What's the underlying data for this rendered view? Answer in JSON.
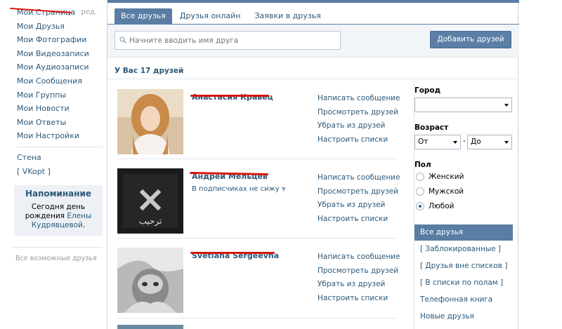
{
  "left_menu": {
    "items": [
      {
        "label": "Мои Страница"
      },
      {
        "label": "Мои Друзья"
      },
      {
        "label": "Мои Фотографии"
      },
      {
        "label": "Мои Видеозаписи"
      },
      {
        "label": "Мои Аудиозаписи"
      },
      {
        "label": "Мои Сообщения"
      },
      {
        "label": "Мои Группы"
      },
      {
        "label": "Мои Новости"
      },
      {
        "label": "Мои Ответы"
      },
      {
        "label": "Мои Настройки"
      }
    ],
    "edit_label": "ред.",
    "extra_items": [
      {
        "label": "Стена"
      },
      {
        "label": "[ VKopt ]"
      }
    ],
    "reminder": {
      "title": "Напоминание",
      "text_before": "Сегодня ",
      "link_day": "день рождения",
      "name": "Елены Кудрявцевой",
      "text_after": "."
    },
    "bottom_link": "Все возможные друзья"
  },
  "tabs": [
    {
      "label": "Все друзья",
      "active": true
    },
    {
      "label": "Друзья онлайн",
      "active": false
    },
    {
      "label": "Заявки в друзья",
      "active": false
    }
  ],
  "search": {
    "placeholder": "Начните вводить имя друга"
  },
  "add_button_label": "Добавить друзей",
  "friends_count_title": "У Вас 17 друзей",
  "friends": [
    {
      "name": "Анастасия Кравец",
      "subtitle": "",
      "actions": [
        "Написать сообщение",
        "Просмотреть друзей",
        "Убрать из друзей",
        "Настроить списки"
      ]
    },
    {
      "name": "Андрей Мельцев",
      "subtitle": "В подписчиках не сижу",
      "avatar_text": "ترحيب",
      "actions": [
        "Написать сообщение",
        "Просмотреть друзей",
        "Убрать из друзей",
        "Настроить списки"
      ]
    },
    {
      "name": "Svetlana Sergeevna",
      "subtitle": "",
      "actions": [
        "Написать сообщение",
        "Просмотреть друзей",
        "Убрать из друзей",
        "Настроить списки"
      ]
    }
  ],
  "filters": {
    "city_label": "Город",
    "city_value": "",
    "age_label": "Возраст",
    "age_from": "От",
    "age_dash": "-",
    "age_to": "До",
    "sex_label": "Пол",
    "sex_options": [
      {
        "label": "Женский",
        "checked": false
      },
      {
        "label": "Мужской",
        "checked": false
      },
      {
        "label": "Любой",
        "checked": true
      }
    ],
    "lists": [
      {
        "label": "Все друзья",
        "active": true
      },
      {
        "label": "[ Заблокированные ]",
        "active": false
      },
      {
        "label": "[ Друзья вне списков ]",
        "active": false
      },
      {
        "label": "[ В списки по полам ]",
        "active": false
      },
      {
        "label": "Телефонная книга",
        "active": false
      },
      {
        "label": "Новые друзья",
        "active": false
      }
    ]
  },
  "colors": {
    "accent": "#597da3",
    "link": "#2b587a",
    "redaction": "#d8180f"
  }
}
